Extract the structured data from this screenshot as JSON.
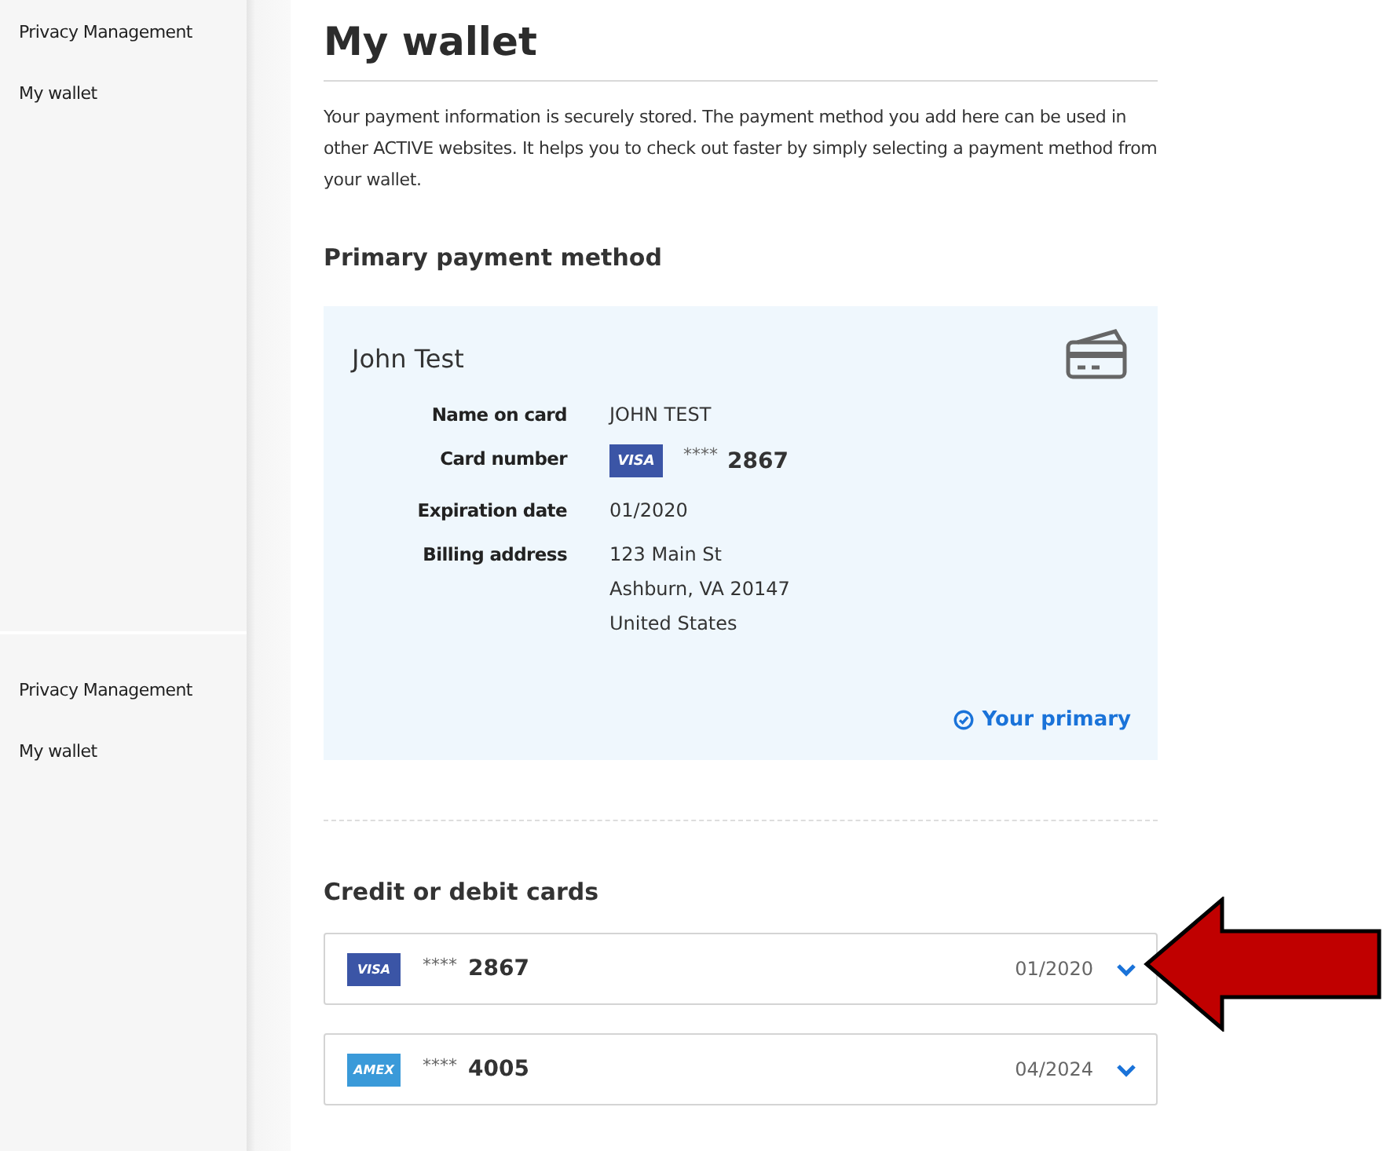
{
  "sidebar_groups": [
    {
      "items": [
        {
          "label": "Privacy Management"
        },
        {
          "label": "My wallet"
        }
      ]
    },
    {
      "items": [
        {
          "label": "Privacy Management"
        },
        {
          "label": "My wallet"
        }
      ]
    }
  ],
  "page": {
    "title": "My wallet",
    "intro": "Your payment information is securely stored. The payment method you add here can be used in other ACTIVE websites. It helps you to check out faster by simply selecting a payment method from your wallet."
  },
  "primary": {
    "heading": "Primary payment method",
    "holder": "John Test",
    "fields": [
      {
        "kind": "text",
        "label": "Name on card",
        "lines": [
          "JOHN TEST"
        ]
      },
      {
        "kind": "card",
        "label": "Card number",
        "brand": "VISA",
        "mask": "****",
        "last4": "2867"
      },
      {
        "kind": "text",
        "label": "Expiration date",
        "lines": [
          "01/2020"
        ]
      },
      {
        "kind": "text",
        "label": "Billing address",
        "lines": [
          "123 Main St",
          "Ashburn, VA 20147",
          "United States"
        ]
      }
    ],
    "status": "Your primary"
  },
  "cards": {
    "heading": "Credit or debit cards",
    "items": [
      {
        "brand": "VISA",
        "color": "#3b55a6",
        "mask": "****",
        "last4": "2867",
        "expiry": "01/2020",
        "expanded": false,
        "pointed": true
      },
      {
        "brand": "AMEX",
        "color": "#3a9ad9",
        "mask": "****",
        "last4": "4005",
        "expiry": "04/2024",
        "expanded": false,
        "pointed": false
      }
    ]
  }
}
